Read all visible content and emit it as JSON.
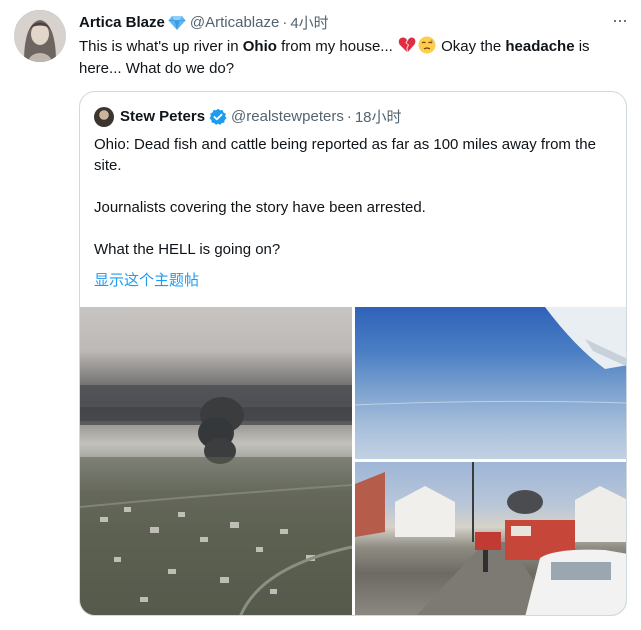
{
  "tweet": {
    "author_name": "Artica Blaze",
    "handle": "@Articablaze",
    "separator": "·",
    "time": "4小时",
    "more_label": "···",
    "text": {
      "part1": "This is what's up river in ",
      "bold1": "Ohio",
      "part2": " from my house... ",
      "part3": " Okay the ",
      "bold2": "headache",
      "part4": " is here... What do we do?"
    },
    "emojis": [
      "broken-heart-emoji",
      "weary-face-emoji"
    ]
  },
  "quote": {
    "author_name": "Stew Peters",
    "handle": "@realstewpeters",
    "separator": "·",
    "time": "18小时",
    "paragraphs": [
      "Ohio: Dead fish and cattle being reported as far as 100 miles away from the site.",
      "Journalists covering the story have been arrested.",
      "What the HELL is going on?"
    ],
    "show_thread": "显示这个主题帖"
  },
  "media": [
    {
      "name": "smoke-plume-over-town-photo"
    },
    {
      "name": "airplane-window-sky-photo"
    },
    {
      "name": "street-emergency-vehicles-photo"
    }
  ],
  "colors": {
    "text": "#0f1419",
    "secondary": "#536471",
    "link": "#1d9bf0",
    "border": "#cfd9de",
    "verified_blue": "#1d9bf0",
    "diamond_blue": "#5fb3f0"
  }
}
